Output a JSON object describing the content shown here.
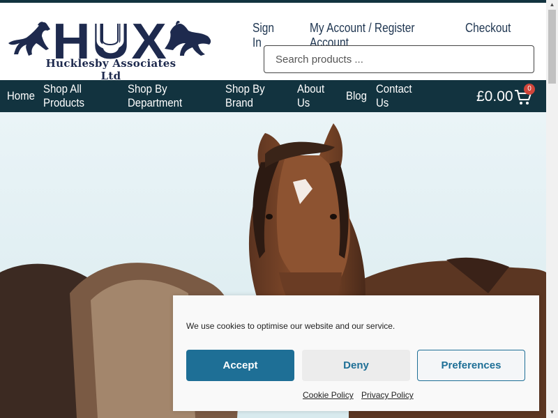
{
  "brand": {
    "logo_text": "HUX",
    "company_name": "Hucklesby Associates Ltd"
  },
  "top_links": [
    "Sign In",
    "My Account / Register Account",
    "Checkout"
  ],
  "search": {
    "placeholder": "Search products ..."
  },
  "nav": {
    "items": [
      "Home",
      "Shop All Products",
      "Shop By Department",
      "Shop By Brand",
      "About Us",
      "Blog",
      "Contact Us"
    ],
    "cart_total": "£0.00",
    "cart_count": "0"
  },
  "cookie_banner": {
    "message": "We use cookies to optimise our website and our service.",
    "accept_label": "Accept",
    "deny_label": "Deny",
    "preferences_label": "Preferences",
    "cookie_policy_label": "Cookie Policy",
    "privacy_policy_label": "Privacy Policy"
  },
  "colors": {
    "nav_background": "#12333f",
    "accent": "#1e6f96",
    "logo_navy": "#1e2a4e",
    "badge_red": "#d0453a"
  },
  "icons": [
    "horse-silhouette-icon",
    "horseshoe-icon",
    "cart-icon"
  ]
}
